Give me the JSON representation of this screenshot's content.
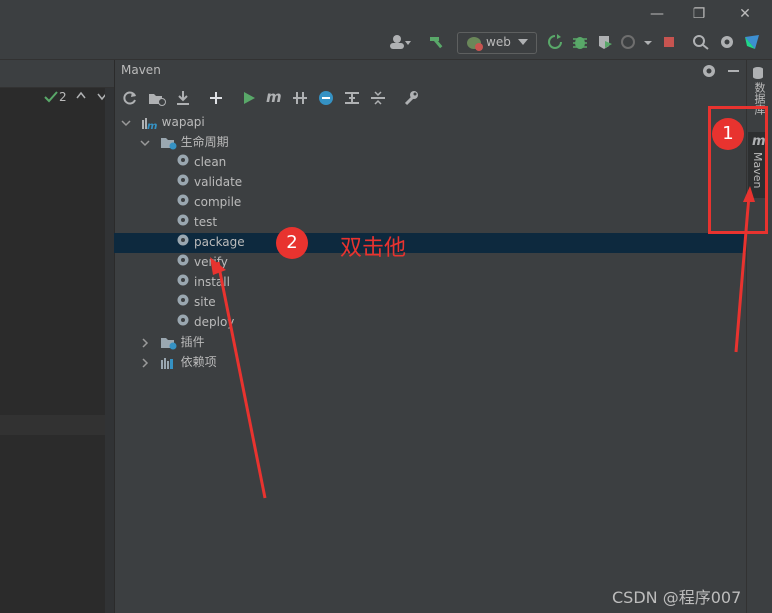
{
  "window": {
    "minimize": "—",
    "restore": "❐",
    "close": "✕"
  },
  "toolbar": {
    "run_config": "web"
  },
  "editor": {
    "inspection_count": "2"
  },
  "panel": {
    "title": "Maven",
    "tree": {
      "root": "wapapi",
      "lifecycle": "生命周期",
      "phases": [
        "clean",
        "validate",
        "compile",
        "test",
        "package",
        "verify",
        "install",
        "site",
        "deploy"
      ],
      "plugins": "插件",
      "dependencies": "依赖项"
    }
  },
  "right_stripe": {
    "database": "数据库",
    "maven": "Maven"
  },
  "annotations": {
    "badge1": "1",
    "badge2": "2",
    "note": "双击他"
  },
  "watermark": "CSDN @程序007",
  "colors": {
    "accent": "#e8332f",
    "selection": "#0d293e"
  }
}
